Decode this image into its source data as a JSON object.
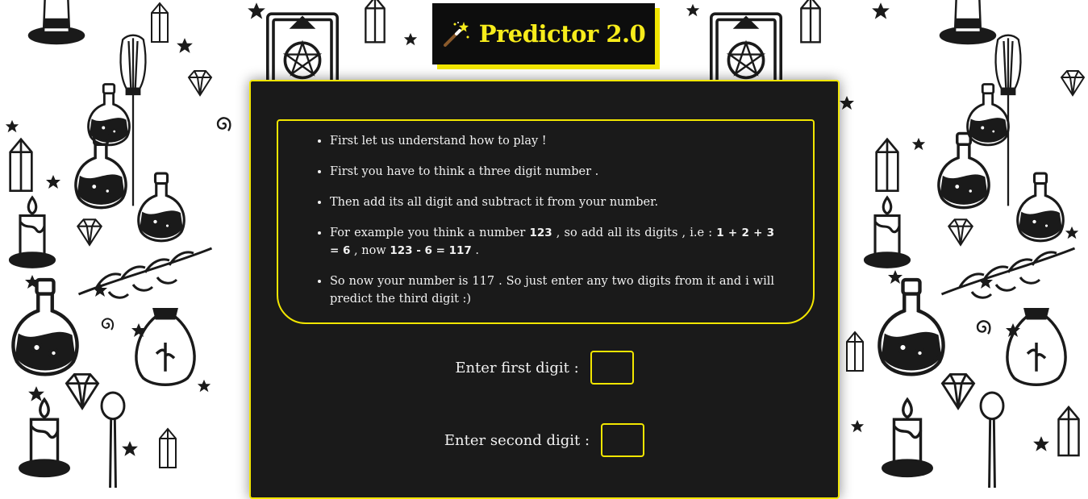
{
  "app": {
    "title": "Predictor 2.0",
    "title_icon": "magic-wand-icon"
  },
  "colors": {
    "accent": "#f2e600",
    "panel": "#1a1a1a",
    "title_bg": "#0d0d0d",
    "text": "#f2f2f2"
  },
  "instructions": {
    "items": [
      {
        "parts": [
          {
            "t": "First let us understand how to play !"
          }
        ]
      },
      {
        "parts": [
          {
            "t": "First you have to think a three digit number ."
          }
        ]
      },
      {
        "parts": [
          {
            "t": "Then add its all digit and subtract it from your number."
          }
        ]
      },
      {
        "parts": [
          {
            "t": "For example you think a number "
          },
          {
            "t": "123",
            "b": true
          },
          {
            "t": " , so add all its digits , i.e : "
          },
          {
            "t": "1 + 2 + 3 = 6",
            "b": true
          },
          {
            "t": " , now "
          },
          {
            "t": "123 - 6 = 117",
            "b": true
          },
          {
            "t": " ."
          }
        ]
      },
      {
        "parts": [
          {
            "t": "So now your number is 117 . So just enter any two digits from it and i will predict the third digit :)"
          }
        ]
      }
    ]
  },
  "form": {
    "first_label": "Enter first digit :",
    "first_value": "",
    "second_label": "Enter second digit :",
    "second_value": ""
  },
  "background": {
    "pattern": "witchcraft-doodle-pattern",
    "icons": [
      "hat-icon",
      "crystal-icon",
      "broom-icon",
      "spellbook-icon",
      "potion-icon",
      "candle-icon",
      "star-icon",
      "gem-icon",
      "pouch-icon",
      "spoon-icon",
      "herb-icon",
      "spiral-icon"
    ]
  }
}
